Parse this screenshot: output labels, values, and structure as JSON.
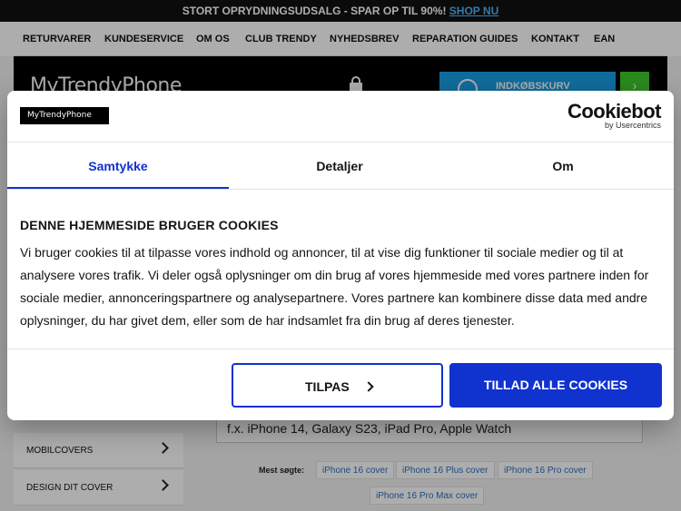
{
  "promo": {
    "text": "STORT OPRYDNINGSUDSALG - SPAR OP TIL 90%!",
    "link": "SHOP NU"
  },
  "nav": {
    "items": [
      "RETURVARER",
      "KUNDESERVICE",
      "OM OS",
      "CLUB TRENDY",
      "NYHEDSBREV",
      "REPARATION GUIDES",
      "KONTAKT",
      "EAN"
    ]
  },
  "header": {
    "brand": "MyTrendyPhone",
    "cart_label": "INDKØBSKURV",
    "go_arrow": "›"
  },
  "page": {
    "search_placeholder": "f.x. iPhone 14, Galaxy S23, iPad Pro, Apple Watch",
    "sidebar": [
      "MOBILCOVERS",
      "DESIGN DIT COVER"
    ],
    "most_searched_label": "Mest søgte:",
    "most_searched": [
      "iPhone 16 cover",
      "iPhone 16 Plus cover",
      "iPhone 16 Pro cover",
      "iPhone 16 Pro Max cover"
    ]
  },
  "modal": {
    "site_logo": "MyTrendyPhone",
    "cookiebot_brand": "Cookiebot",
    "cookiebot_sub": "by Usercentrics",
    "tabs": [
      "Samtykke",
      "Detaljer",
      "Om"
    ],
    "heading": "DENNE HJEMMESIDE BRUGER COOKIES",
    "body": "Vi bruger cookies til at tilpasse vores indhold og annoncer, til at vise dig funktioner til sociale medier og til at analysere vores trafik. Vi deler også oplysninger om din brug af vores hjemmeside med vores partnere inden for sociale medier, annonceringspartnere og analysepartnere. Vores partnere kan kombinere disse data med andre oplysninger, du har givet dem, eller som de har indsamlet fra din brug af deres tjenester.",
    "customize_label": "TILPAS",
    "allow_all_label": "TILLAD ALLE COOKIES"
  },
  "colors": {
    "accent": "#1032cf",
    "cart": "#1aa0e8",
    "go": "#3ecc2b"
  }
}
